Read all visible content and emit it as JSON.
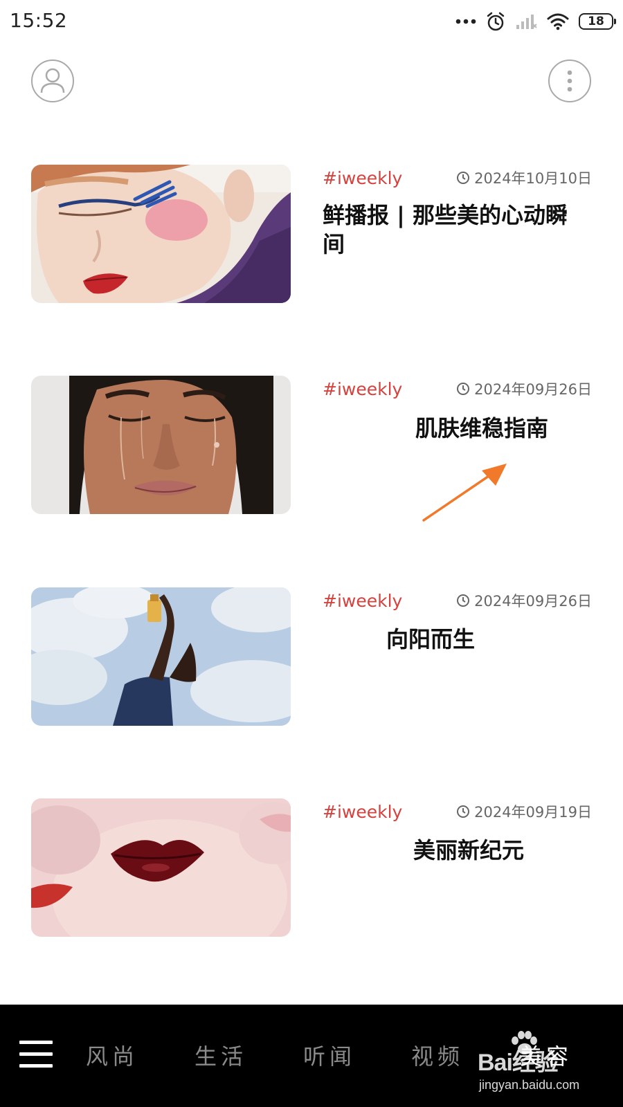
{
  "status_bar": {
    "time": "15:52",
    "battery": "18",
    "icons": [
      "more-dots-icon",
      "alarm-icon",
      "signal-icon",
      "wifi-icon",
      "battery-icon"
    ]
  },
  "header": {
    "profile_icon": "person-icon",
    "menu_icon": "vertical-dots-icon"
  },
  "articles": [
    {
      "tag": "#iweekly",
      "date": "2024年10月10日",
      "title": "鲜播报 | 那些美的心动瞬间",
      "image": "makeup-portrait"
    },
    {
      "tag": "#iweekly",
      "date": "2024年09月26日",
      "title": "肌肤维稳指南",
      "image": "wet-face-portrait"
    },
    {
      "tag": "#iweekly",
      "date": "2024年09月26日",
      "title": "向阳而生",
      "image": "arm-holding-bottle-sky"
    },
    {
      "tag": "#iweekly",
      "date": "2024年09月19日",
      "title": "美丽新纪元",
      "image": "red-lips-closeup"
    }
  ],
  "annotation": {
    "color": "#f07a2a"
  },
  "bottom_nav": {
    "menu_icon": "hamburger-icon",
    "items": [
      "风尚",
      "生活",
      "听闻",
      "视频",
      "美容"
    ],
    "active_index": 4
  },
  "watermark": {
    "logo": "Bai经验",
    "url": "jingyan.baidu.com"
  },
  "colors": {
    "tag": "#d5413c",
    "nav_bg": "#000000",
    "nav_text": "#8a8a8a",
    "nav_text_active": "#ffffff"
  }
}
